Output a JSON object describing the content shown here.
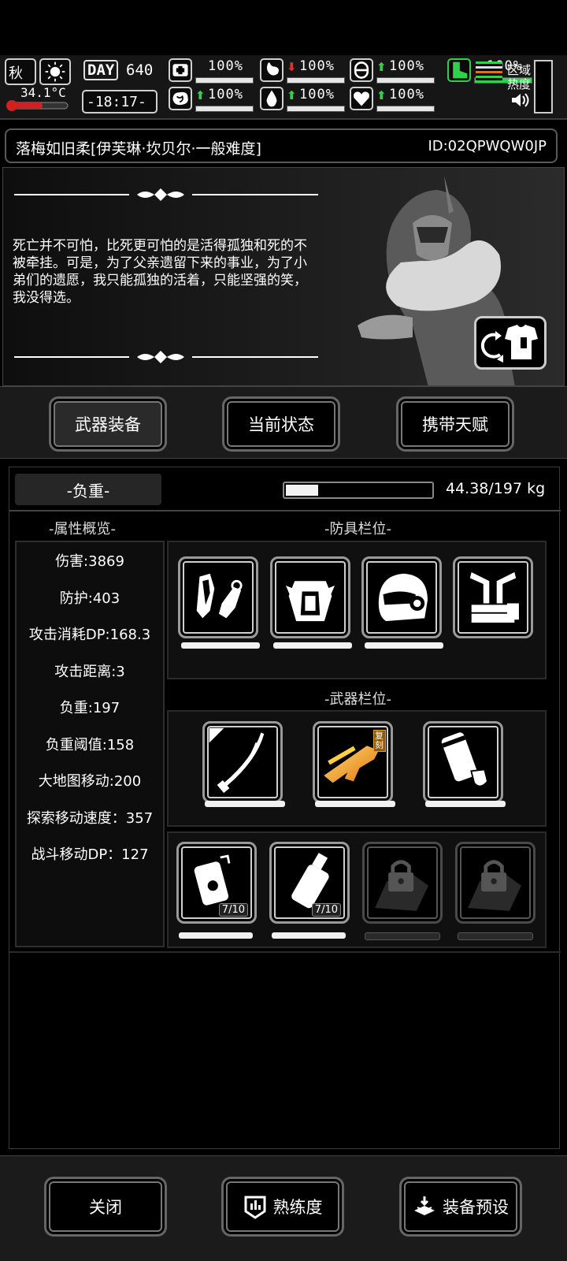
{
  "status": {
    "season": "秋",
    "temperature": "34.1°C",
    "day_label": "DAY",
    "day": "640",
    "time": "-18:17-",
    "stats": [
      {
        "name": "health",
        "icon": "medkit-icon",
        "value": "100%",
        "trend": "none"
      },
      {
        "name": "hunger",
        "icon": "stomach-icon",
        "value": "100%",
        "trend": "down"
      },
      {
        "name": "capsule",
        "icon": "pill-icon",
        "value": "100%",
        "trend": "up"
      },
      {
        "name": "brain",
        "icon": "brain-icon",
        "value": "100%",
        "trend": "up"
      },
      {
        "name": "water",
        "icon": "water-drop-icon",
        "value": "100%",
        "trend": "up"
      },
      {
        "name": "heart",
        "icon": "heart-icon",
        "value": "100%",
        "trend": "up"
      },
      {
        "name": "stamina",
        "icon": "boot-icon",
        "value": "100%",
        "trend": "up"
      }
    ],
    "region_heat_label": "区域热度"
  },
  "character": {
    "name": "落梅如旧柔[伊芙琳·坎贝尔·一般难度]",
    "id": "ID:02QPWQW0JP"
  },
  "story": {
    "quote": "死亡并不可怕，比死更可怕的是活得孤独和死的不被牵挂。可是，为了父亲遗留下来的事业，为了小弟们的遗愿，我只能孤独的活着，只能坚强的笑，我没得选。"
  },
  "tabs": {
    "weapons_equipment": "武器装备",
    "current_status": "当前状态",
    "carried_talent": "携带天赋"
  },
  "load": {
    "label": "-负重-",
    "value": "44.38/197 kg",
    "fraction": 0.225
  },
  "attributes": {
    "title": "-属性概览-",
    "items": [
      "伤害:3869",
      "防护:403",
      "攻击消耗DP:168.3",
      "攻击距离:3",
      "负重:197",
      "负重阈值:158",
      "大地图移动:200",
      "探索移动速度：357",
      "战斗移动DP：127"
    ]
  },
  "armor": {
    "title": "-防具栏位-",
    "slots": [
      "gloves-icon",
      "chest-armor-icon",
      "helmet-icon",
      "armor-rack-icon"
    ]
  },
  "weapons": {
    "title": "-武器栏位-",
    "slots": [
      "katana-icon",
      "gold-rifle-icon",
      "shield-pack-icon"
    ],
    "badge": "复刻",
    "items": [
      {
        "icon": "grenade-icon",
        "count": "7/10"
      },
      {
        "icon": "flask-icon",
        "count": "7/10"
      },
      {
        "icon": "locked-slot-icon",
        "count": ""
      },
      {
        "icon": "locked-slot-icon",
        "count": ""
      }
    ]
  },
  "buttons": {
    "close": "关闭",
    "proficiency": "熟练度",
    "equipment_preset": "装备预设"
  },
  "colors": {
    "accent_green": "#2fd24a",
    "alert_red": "#e03030",
    "gold": "#f0a020"
  }
}
